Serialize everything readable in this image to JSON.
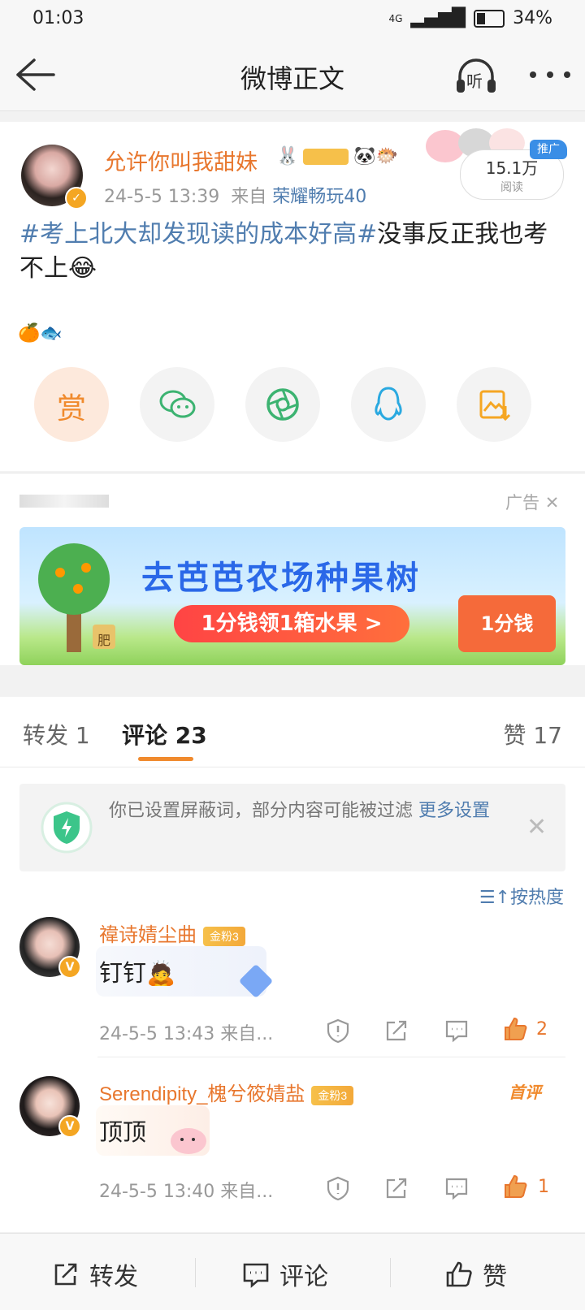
{
  "status": {
    "time": "01:03",
    "battery": "34%",
    "network": "4G"
  },
  "header": {
    "title": "微博正文",
    "listen_label": "听"
  },
  "post": {
    "author": "允许你叫我甜妹",
    "time": "24-5-5 13:39",
    "from_prefix": "来自",
    "device": "荣耀畅玩40",
    "read_count": "15.1万",
    "read_label": "阅读",
    "promo_badge": "推广",
    "body_tag": "#考上北大却发现读的成本好高#",
    "body_text": "没事反正我也考不上",
    "emojis": "🍊🐟",
    "reward_label": "赏"
  },
  "ad": {
    "label": "广告",
    "banner_title": "去芭芭农场种果树",
    "banner_cta": "1分钱领1箱水果 >",
    "banner_box": "1分钱",
    "tree_tag": "肥"
  },
  "tabs": {
    "repost": "转发 1",
    "comment": "评论 23",
    "like": "赞 17"
  },
  "notice": {
    "text": "你已设置屏蔽词，部分内容可能被过滤 ",
    "link": "更多设置"
  },
  "sort_label": "按热度",
  "comments": [
    {
      "name": "禕诗婧尘曲",
      "fan": "金粉3",
      "text": "钉钉",
      "time": "24-5-5 13:43 来自...",
      "likes": "2",
      "first": ""
    },
    {
      "name": "Serendipity_槐兮筱婧盐",
      "fan": "金粉3",
      "text": "顶顶",
      "time": "24-5-5 13:40 来自...",
      "likes": "1",
      "first": "首评"
    }
  ],
  "bottom": {
    "repost": "转发",
    "comment": "评论",
    "like": "赞"
  },
  "colors": {
    "accent": "#e8772e",
    "link": "#507daf",
    "orange": "#f08a2d"
  }
}
